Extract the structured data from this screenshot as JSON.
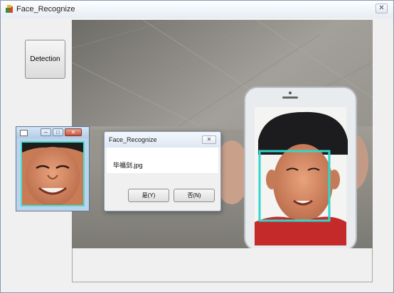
{
  "window": {
    "title": "Face_Recognize"
  },
  "toolbar": {
    "detection_label": "Detection"
  },
  "dialog": {
    "title": "Face_Recognize",
    "message": "毕福剑.jpg",
    "yes_label": "是(Y)",
    "no_label": "否(N)",
    "close_symbol": "✕"
  },
  "face_window": {
    "minimize_symbol": "–",
    "maximize_symbol": "□",
    "close_symbol": "✕"
  },
  "colors": {
    "detection_box": "#31d6cc",
    "face_border": "#45e0d2"
  }
}
